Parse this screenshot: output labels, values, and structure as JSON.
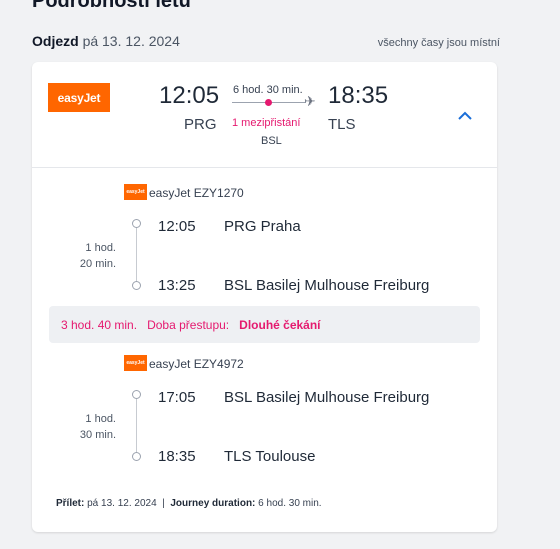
{
  "page_title": "Podrobnosti letu",
  "departure_label": "Odjezd",
  "departure_date": "pá 13. 12. 2024",
  "local_times_note": "všechny časy jsou místní",
  "summary": {
    "airline": "easyJet",
    "dep_time": "12:05",
    "arr_time": "18:35",
    "dep_code": "PRG",
    "arr_code": "TLS",
    "duration": "6 hod. 30 min.",
    "stops": "1 mezipřistání",
    "via": "BSL"
  },
  "segments": [
    {
      "airline_logo": "easyJet",
      "flight": "easyJet EZY1270",
      "duration_line1": "1 hod.",
      "duration_line2": "20 min.",
      "dep_time": "12:05",
      "dep_place": "PRG Praha",
      "arr_time": "13:25",
      "arr_place": "BSL Basilej Mulhouse Freiburg"
    },
    {
      "airline_logo": "easyJet",
      "flight": "easyJet EZY4972",
      "duration_line1": "1 hod.",
      "duration_line2": "30 min.",
      "dep_time": "17:05",
      "dep_place": "BSL Basilej Mulhouse Freiburg",
      "arr_time": "18:35",
      "arr_place": "TLS Toulouse"
    }
  ],
  "layover": {
    "duration": "3 hod. 40 min.",
    "label": "Doba přestupu:",
    "note": "Dlouhé čekání"
  },
  "footer": {
    "arrival_label": "Přílet:",
    "arrival_date": "pá 13. 12. 2024",
    "separator": "|",
    "journey_label": "Journey duration:",
    "journey_value": "6 hod. 30 min."
  },
  "colors": {
    "brand": "#ff6600",
    "accent": "#e5196f",
    "link": "#1a6ed8"
  },
  "icons": {
    "plane": "plane-icon",
    "collapse": "chevron-up-icon"
  }
}
